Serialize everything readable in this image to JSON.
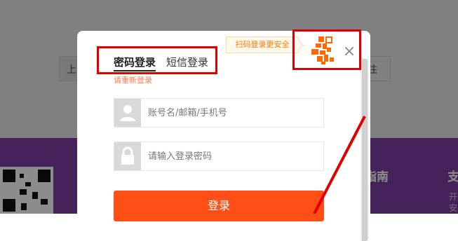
{
  "background": {
    "left_input_text": "上",
    "right_input_text": "注",
    "band_heading_1": "指南",
    "band_heading_2": "支",
    "band_small_text": "开",
    "band_small_text_2": "安"
  },
  "modal": {
    "tabs": [
      {
        "label": "密码登录",
        "active": true
      },
      {
        "label": "短信登录",
        "active": false
      }
    ],
    "relogin_hint": "请重新登录",
    "scan_tip": "扫码登录更安全",
    "close_symbol": "×",
    "username": {
      "placeholder": "账号名/邮箱/手机号",
      "icon": "user-icon"
    },
    "password": {
      "placeholder": "请输入登录密码",
      "icon": "lock-icon"
    },
    "login_button": "登录"
  },
  "colors": {
    "primary": "#ff4e16",
    "hint": "#ff7b4c",
    "tip_text": "#ff7a00",
    "qr_orange": "#ff6a00",
    "annotation": "#e00000",
    "band": "#7e3fa4"
  }
}
